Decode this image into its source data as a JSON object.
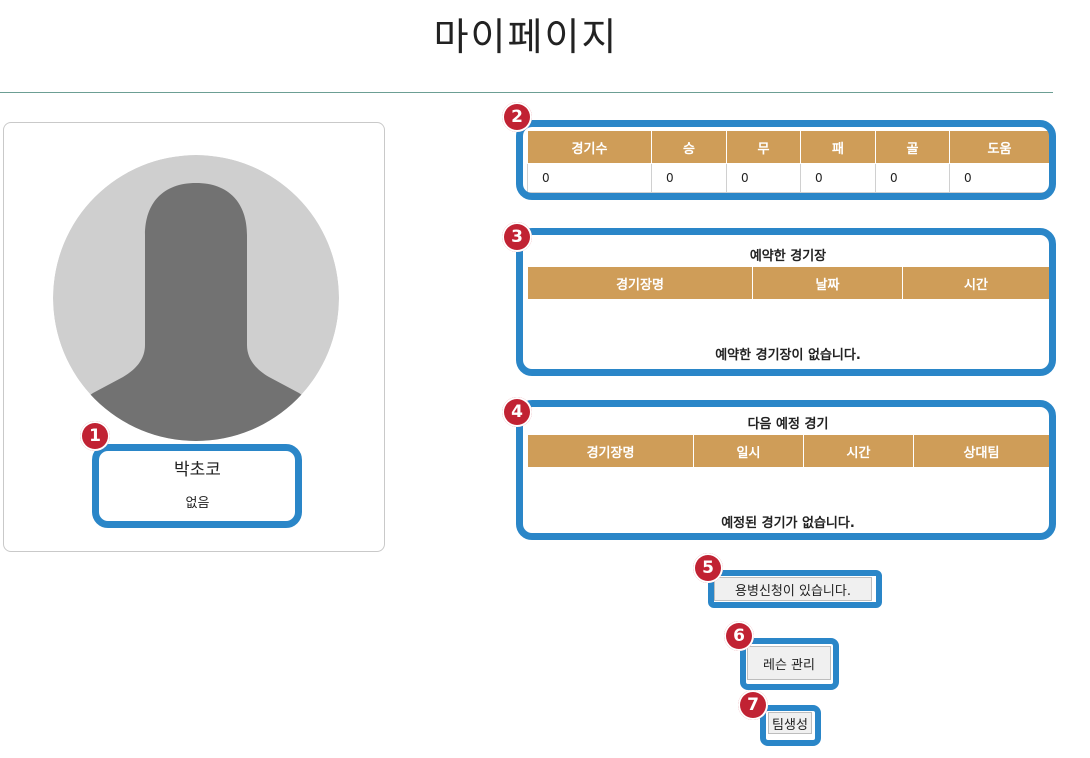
{
  "page_title": "마이페이지",
  "profile": {
    "name": "박초코",
    "position": "없음"
  },
  "badges": [
    "1",
    "2",
    "3",
    "4",
    "5",
    "6",
    "7"
  ],
  "stats": {
    "headers": [
      "경기수",
      "승",
      "무",
      "패",
      "골",
      "도움"
    ],
    "values": [
      "0",
      "0",
      "0",
      "0",
      "0",
      "0"
    ]
  },
  "reservations": {
    "title": "예약한 경기장",
    "headers": [
      "경기장명",
      "날짜",
      "시간"
    ],
    "empty_message": "예약한 경기장이 없습니다."
  },
  "upcoming": {
    "title": "다음 예정 경기",
    "headers": [
      "경기장명",
      "일시",
      "시간",
      "상대팀"
    ],
    "empty_message": "예정된 경기가 없습니다."
  },
  "buttons": {
    "mercenary_label": "용병신청이 있습니다.",
    "lesson_label": "레슨 관리",
    "team_label": "팀생성"
  },
  "colors": {
    "header_bg": "#cf9d58",
    "highlight": "#2a86c8",
    "badge": "#c12233",
    "divider": "#6c9e94"
  }
}
